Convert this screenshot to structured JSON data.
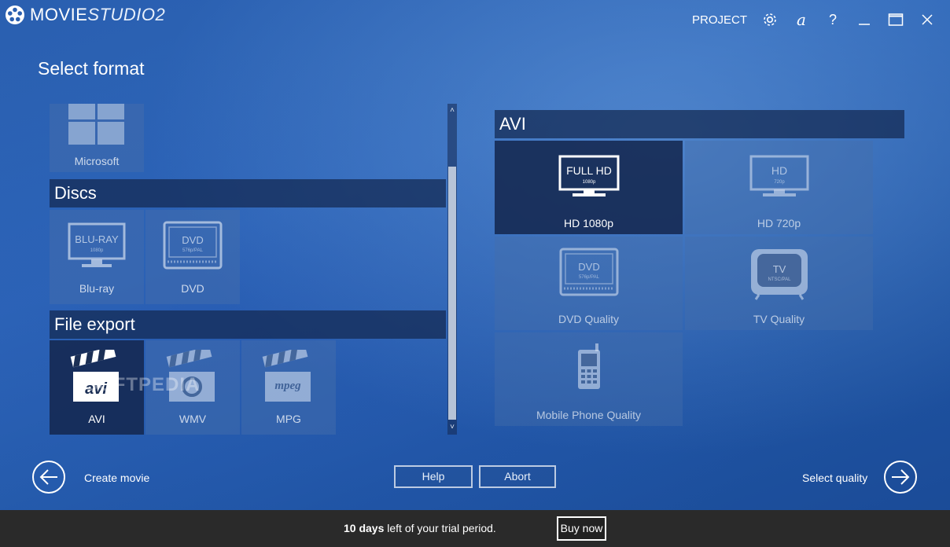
{
  "app": {
    "title_main": "MOVIE",
    "title_sub": "STUDIO2",
    "project_label": "PROJECT"
  },
  "page": {
    "title": "Select format"
  },
  "left": {
    "top_partial_tile": "Microsoft",
    "sections": [
      {
        "title": "Discs",
        "tiles": [
          {
            "label": "Blu-ray",
            "art": "BLU-RAY",
            "art_sub": "1080p"
          },
          {
            "label": "DVD",
            "art": "DVD",
            "art_sub": "576p/PAL"
          }
        ]
      },
      {
        "title": "File export",
        "tiles": [
          {
            "label": "AVI",
            "art": "avi"
          },
          {
            "label": "WMV",
            "art": "wmv"
          },
          {
            "label": "MPG",
            "art": "mpeg"
          }
        ]
      }
    ]
  },
  "right": {
    "title": "AVI",
    "tiles": [
      {
        "label": "HD 1080p",
        "art": "FULL HD",
        "art_sub": "1080p",
        "selected": true
      },
      {
        "label": "HD 720p",
        "art": "HD",
        "art_sub": "720p"
      },
      {
        "label": "DVD Quality",
        "art": "DVD",
        "art_sub": "576p/PAL"
      },
      {
        "label": "TV Quality",
        "art": "TV",
        "art_sub": "NTSC/PAL"
      },
      {
        "label": "Mobile Phone Quality"
      }
    ]
  },
  "nav": {
    "back_label": "Create movie",
    "help_label": "Help",
    "abort_label": "Abort",
    "next_label": "Select quality"
  },
  "trial": {
    "days": "10 days",
    "rest": " left of your trial period.",
    "buy_label": "Buy now"
  },
  "watermark": "SOFTPEDIA"
}
